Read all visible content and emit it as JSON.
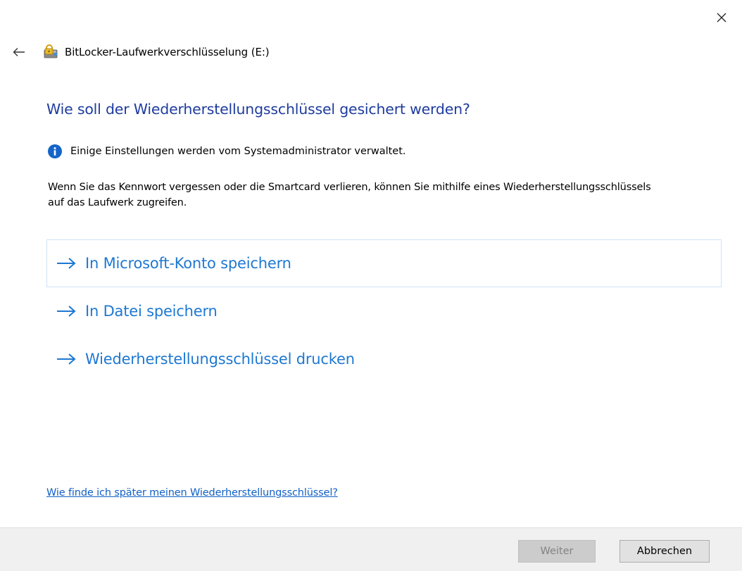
{
  "window": {
    "title": "BitLocker-Laufwerkverschlüsselung (E:)"
  },
  "main": {
    "heading": "Wie soll der Wiederherstellungsschlüssel gesichert werden?",
    "info_text": "Einige Einstellungen werden vom Systemadministrator verwaltet.",
    "description": "Wenn Sie das Kennwort vergessen oder die Smartcard verlieren, können Sie mithilfe eines Wiederherstellungsschlüssels auf das Laufwerk zugreifen.",
    "options": [
      {
        "label": "In Microsoft-Konto speichern"
      },
      {
        "label": "In Datei speichern"
      },
      {
        "label": "Wiederherstellungsschlüssel drucken"
      }
    ],
    "help_link": "Wie finde ich später meinen Wiederherstellungsschlüssel?"
  },
  "footer": {
    "next_label": "Weiter",
    "cancel_label": "Abbrechen"
  },
  "colors": {
    "heading": "#1e3c9e",
    "option_link": "#1e78d2",
    "help_link": "#1160c4",
    "info_icon": "#1565c8"
  }
}
